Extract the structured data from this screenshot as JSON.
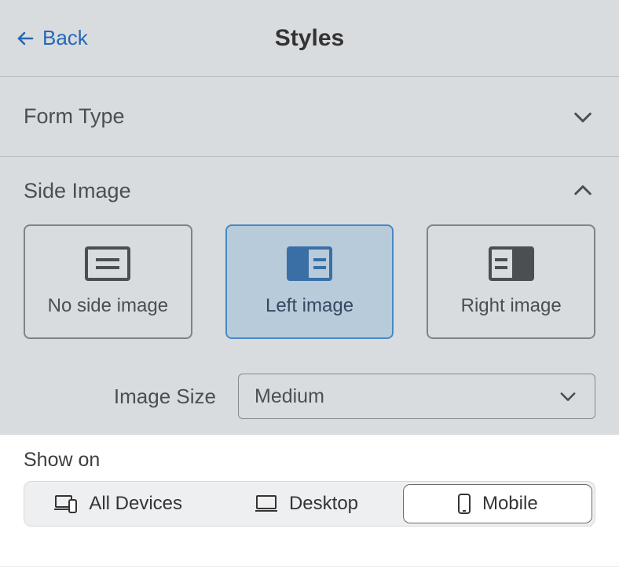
{
  "header": {
    "back_label": "Back",
    "title": "Styles"
  },
  "sections": {
    "form_type": {
      "label": "Form Type",
      "expanded": false
    },
    "side_image": {
      "label": "Side Image",
      "expanded": true,
      "options": [
        {
          "id": "none",
          "label": "No side image",
          "selected": false
        },
        {
          "id": "left",
          "label": "Left image",
          "selected": true
        },
        {
          "id": "right",
          "label": "Right image",
          "selected": false
        }
      ],
      "image_size": {
        "label": "Image Size",
        "value": "Medium"
      }
    }
  },
  "show_on": {
    "label": "Show on",
    "options": [
      {
        "id": "all",
        "label": "All Devices",
        "selected": false
      },
      {
        "id": "desktop",
        "label": "Desktop",
        "selected": false
      },
      {
        "id": "mobile",
        "label": "Mobile",
        "selected": true
      }
    ]
  }
}
